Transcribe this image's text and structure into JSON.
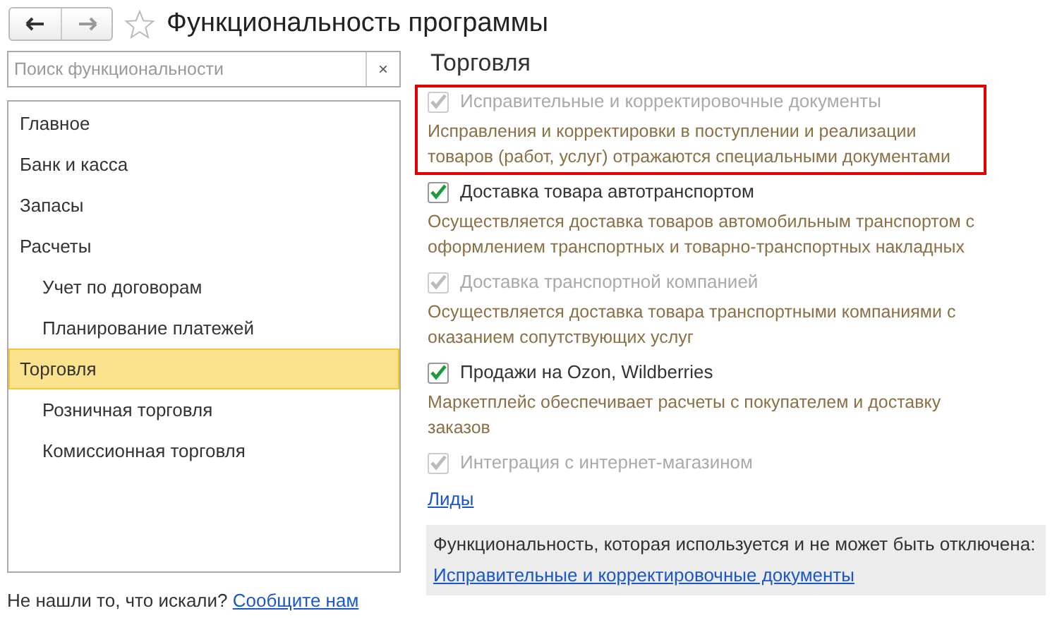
{
  "window": {
    "title": "Функциональность программы",
    "favorite": false
  },
  "search": {
    "placeholder": "Поиск функциональности",
    "clear": "×"
  },
  "sections": [
    {
      "label": "Главное",
      "selected": false
    },
    {
      "label": "Банк и касса",
      "selected": false
    },
    {
      "label": "Запасы",
      "selected": false
    },
    {
      "label": "Расчеты",
      "selected": false,
      "children": [
        {
          "label": "Учет по договорам",
          "selected": false
        },
        {
          "label": "Планирование платежей",
          "selected": false
        }
      ]
    },
    {
      "label": "Торговля",
      "selected": true,
      "children": [
        {
          "label": "Розничная торговля",
          "selected": false
        },
        {
          "label": "Комиссионная торговля",
          "selected": false
        }
      ]
    }
  ],
  "feedback": {
    "text": "Не нашли то, что искали?",
    "link": "Сообщите нам"
  },
  "content": {
    "heading": "Торговля",
    "items": [
      {
        "kind": "option",
        "label": "Исправительные и корректировочные документы",
        "checked": true,
        "disabled": true,
        "highlighted": true,
        "description": "Исправления и корректировки в поступлении и реализации товаров (работ, услуг) отражаются специальными документами"
      },
      {
        "kind": "option",
        "label": "Доставка товара автотранспортом",
        "checked": true,
        "disabled": false,
        "highlighted": false,
        "description": "Осуществляется доставка товаров автомобильным транспортом с оформлением транспортных и товарно-транспортных накладных"
      },
      {
        "kind": "option",
        "label": "Доставка транспортной компанией",
        "checked": true,
        "disabled": true,
        "highlighted": false,
        "description": "Осуществляется доставка товара транспортными компаниями с оказанием сопутствующих услуг"
      },
      {
        "kind": "option",
        "label": "Продажи на Ozon, Wildberries",
        "checked": true,
        "disabled": false,
        "highlighted": false,
        "description": "Маркетплейс обеспечивает расчеты с покупателем и доставку заказов"
      },
      {
        "kind": "option",
        "label": "Интеграция с интернет-магазином",
        "checked": true,
        "disabled": true,
        "highlighted": false
      },
      {
        "kind": "link",
        "label": "Лиды"
      }
    ],
    "locked": {
      "text": "Функциональность, которая используется и не может быть отключена:",
      "links": [
        "Исправительные и корректировочные документы"
      ]
    }
  }
}
